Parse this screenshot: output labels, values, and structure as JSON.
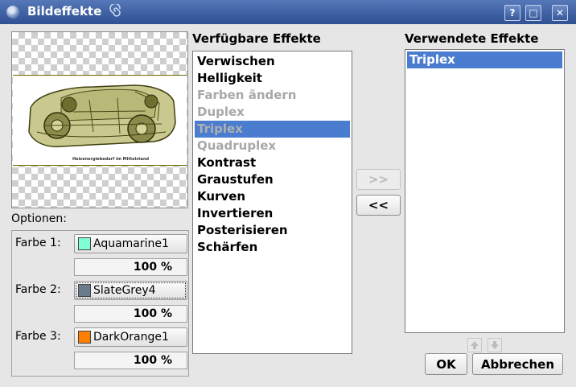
{
  "window": {
    "title": "Bildeffekte",
    "title_icon": "app-globe-icon",
    "buttons": [
      "?",
      "□",
      "✕"
    ]
  },
  "preview": {
    "caption": "Heizenergiebedarf im Mittelstand"
  },
  "options": {
    "label": "Optionen:",
    "colors": [
      {
        "label": "Farbe 1:",
        "name": "Aquamarine1",
        "swatch": "#7fffd4",
        "percent": "100 %"
      },
      {
        "label": "Farbe 2:",
        "name": "SlateGrey4",
        "swatch": "#6c7b8b",
        "percent": "100 %"
      },
      {
        "label": "Farbe 3:",
        "name": "DarkOrange1",
        "swatch": "#ff7f00",
        "percent": "100 %"
      }
    ]
  },
  "available": {
    "label": "Verfügbare Effekte",
    "items": [
      {
        "text": "Verwischen",
        "enabled": true,
        "selected": false
      },
      {
        "text": "Helligkeit",
        "enabled": true,
        "selected": false
      },
      {
        "text": "Farben ändern",
        "enabled": false,
        "selected": false
      },
      {
        "text": "Duplex",
        "enabled": false,
        "selected": false
      },
      {
        "text": "Triplex",
        "enabled": false,
        "selected": true
      },
      {
        "text": "Quadruplex",
        "enabled": false,
        "selected": false
      },
      {
        "text": "Kontrast",
        "enabled": true,
        "selected": false
      },
      {
        "text": "Graustufen",
        "enabled": true,
        "selected": false
      },
      {
        "text": "Kurven",
        "enabled": true,
        "selected": false
      },
      {
        "text": "Invertieren",
        "enabled": true,
        "selected": false
      },
      {
        "text": "Posterisieren",
        "enabled": true,
        "selected": false
      },
      {
        "text": "Schärfen",
        "enabled": true,
        "selected": false
      }
    ]
  },
  "transfer": {
    "add_label": ">>",
    "remove_label": "<<"
  },
  "used": {
    "label": "Verwendete Effekte",
    "items": [
      {
        "text": "Triplex",
        "selected": true
      }
    ]
  },
  "footer": {
    "ok_label": "OK",
    "cancel_label": "Abbrechen"
  },
  "colors": {
    "titlebar": "#3a5c9c",
    "selection": "#4a7dcf",
    "disabled_text": "#a8a8a8"
  }
}
